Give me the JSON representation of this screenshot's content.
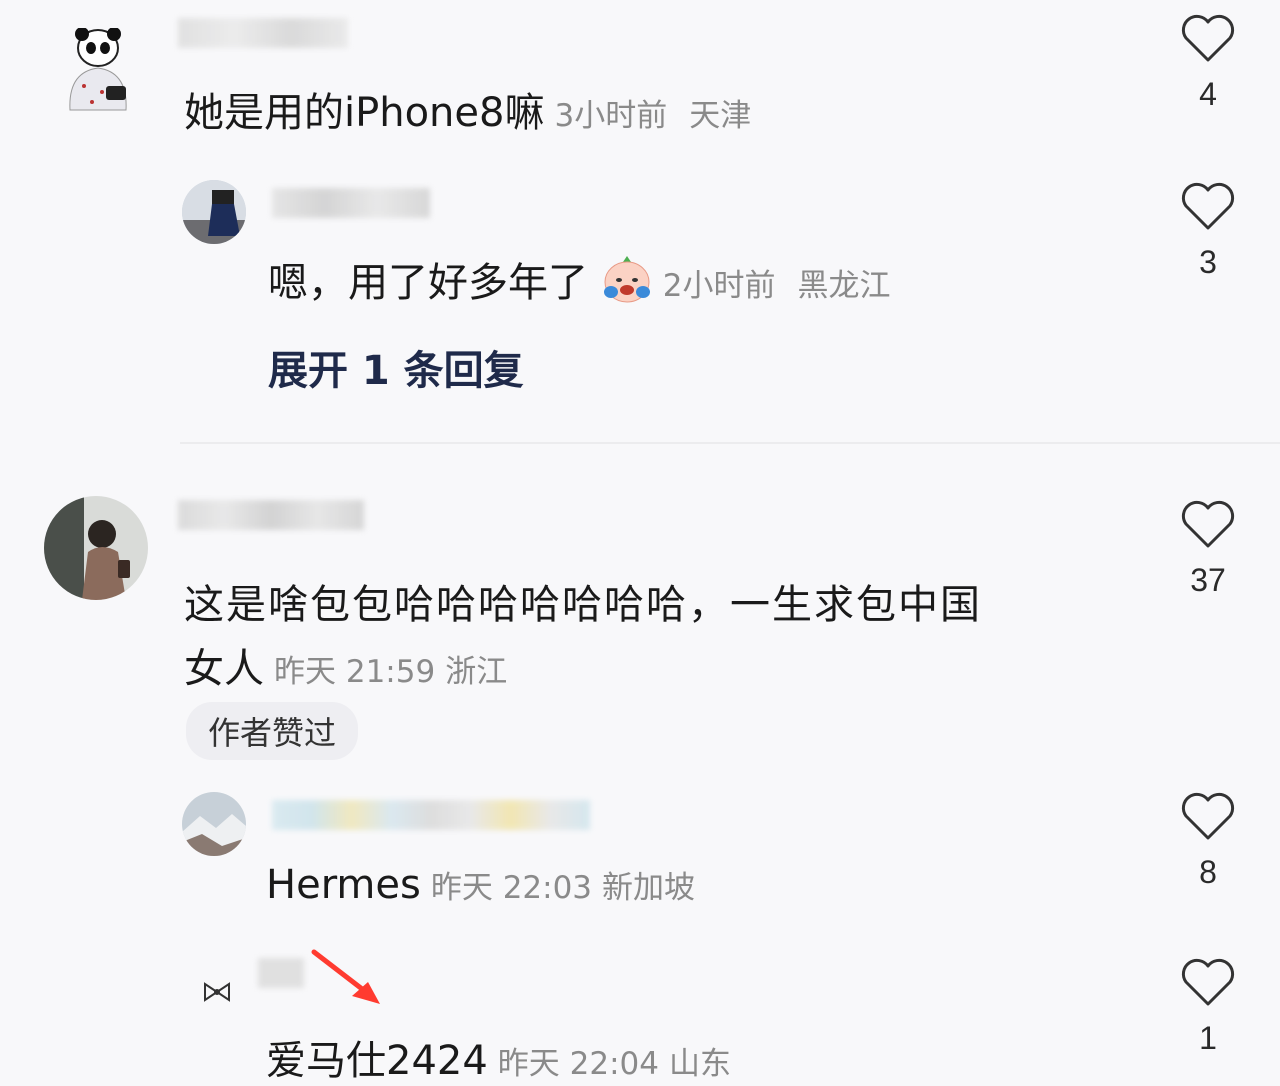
{
  "comments": [
    {
      "text": "她是用的iPhone8嘛",
      "time": "3小时前",
      "location": "天津",
      "likes": "4"
    },
    {
      "text": "嗯，用了好多年了",
      "time": "2小时前",
      "location": "黑龙江",
      "likes": "3"
    },
    {
      "expand_label": "展开 1 条回复"
    },
    {
      "text_line1": "这是啥包包哈哈哈哈哈哈哈，一生求包中国",
      "text_line2": "女人",
      "time": "昨天 21:59",
      "location": "浙江",
      "likes": "37",
      "badge": "作者赞过"
    },
    {
      "text": "Hermes",
      "time": "昨天 22:03",
      "location": "新加坡",
      "likes": "8"
    },
    {
      "text": "爱马仕2424",
      "time": "昨天 22:04",
      "location": "山东",
      "likes": "1"
    }
  ],
  "colors": {
    "background": "#f8f8fa",
    "meta": "#8a8a8a",
    "expand": "#1f2a4a",
    "arrow": "#ff3b30"
  },
  "icons": [
    "heart-outline-icon",
    "crying-emoji-icon",
    "red-arrow-icon",
    "bow-icon"
  ]
}
